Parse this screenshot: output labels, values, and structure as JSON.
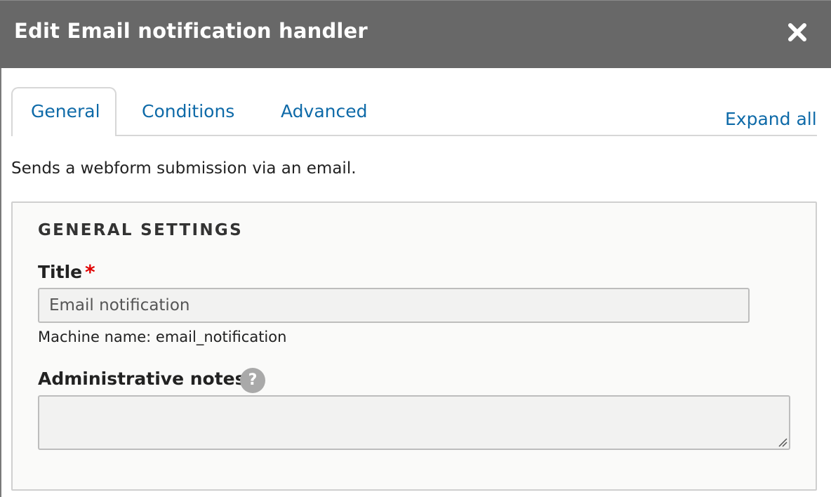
{
  "dialog": {
    "title": "Edit Email notification handler",
    "close_icon": "close-icon"
  },
  "tabs": [
    {
      "label": "General",
      "active": true
    },
    {
      "label": "Conditions",
      "active": false
    },
    {
      "label": "Advanced",
      "active": false
    }
  ],
  "expand_all_label": "Expand all",
  "description": "Sends a webform submission via an email.",
  "general_settings": {
    "legend": "GENERAL SETTINGS",
    "title_field": {
      "label": "Title",
      "required_mark": "*",
      "value": "Email notification",
      "machine_name_label": "Machine name:",
      "machine_name_value": "email_notification"
    },
    "notes_field": {
      "label": "Administrative notes",
      "help_icon": "help-icon",
      "help_glyph": "?",
      "value": ""
    }
  },
  "colors": {
    "titlebar": "#686868",
    "link": "#0e6aa8",
    "required": "#e00000",
    "fieldset_bg": "#fafaf9"
  }
}
